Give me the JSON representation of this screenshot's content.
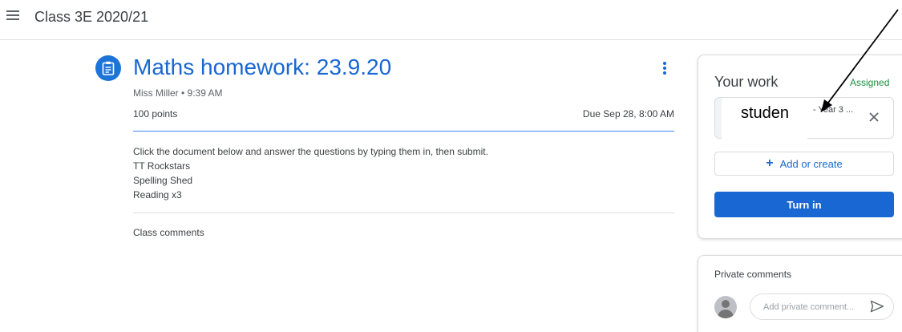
{
  "header": {
    "class_title": "Class 3E 2020/21",
    "menu_icon": "hamburger-menu-icon"
  },
  "assignment": {
    "icon": "assignment-icon",
    "title": "Maths homework: 23.9.20",
    "meta": "Miss Miller • 9:39 AM",
    "points": "100 points",
    "due": "Due Sep 28, 8:00 AM",
    "instructions": [
      "Click the document below and answer the questions by typing them in, then submit.",
      "TT Rockstars",
      "Spelling Shed",
      "Reading x3"
    ],
    "class_comments_label": "Class comments",
    "accent_color": "#1967d2"
  },
  "your_work": {
    "title": "Your work",
    "status": "Assigned",
    "status_color": "#1e8e3e",
    "attachment": {
      "name": "- Year 3 ...",
      "overlay_label": "studen",
      "remove_icon": "close-icon"
    },
    "add_label": "Add or create",
    "turn_in_label": "Turn in"
  },
  "private_comments": {
    "title": "Private comments",
    "placeholder": "Add private comment...",
    "send_icon": "send-icon"
  }
}
